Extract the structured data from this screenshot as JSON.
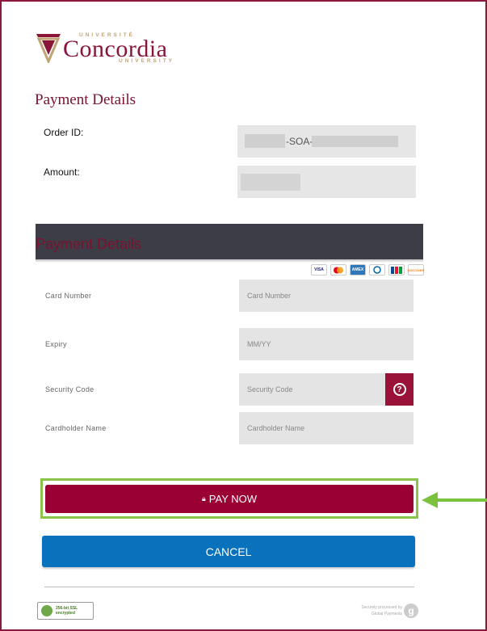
{
  "logo": {
    "top_text": "UNIVERSITÉ",
    "name": "Concordia",
    "bottom_text": "UNIVERSITY"
  },
  "order": {
    "section_title": "Payment Details",
    "order_id_label": "Order ID:",
    "order_id_visible": "-SOA-",
    "amount_label": "Amount:"
  },
  "payment": {
    "header": "Payment Details",
    "cards": [
      "VISA",
      "MC",
      "AMEX",
      "DINERS",
      "JCB",
      "DISCOVER"
    ],
    "card_number_label": "Card Number",
    "card_number_placeholder": "Card Number",
    "expiry_label": "Expiry",
    "expiry_placeholder": "MM/YY",
    "security_label": "Security Code",
    "security_placeholder": "Security Code",
    "cardholder_label": "Cardholder Name",
    "cardholder_placeholder": "Cardholder Name"
  },
  "actions": {
    "pay_now": "PAY NOW",
    "cancel": "CANCEL"
  },
  "footer": {
    "ssl_line1": "256-bit SSL",
    "ssl_line2": "encrypted",
    "secured_line1": "Securely processed by",
    "secured_line2": "Global Payments",
    "secured_logo": "g"
  },
  "colors": {
    "brand": "#8a1538",
    "pay_button": "#9b0035",
    "cancel_button": "#0a72bc",
    "highlight": "#8bc34a"
  }
}
